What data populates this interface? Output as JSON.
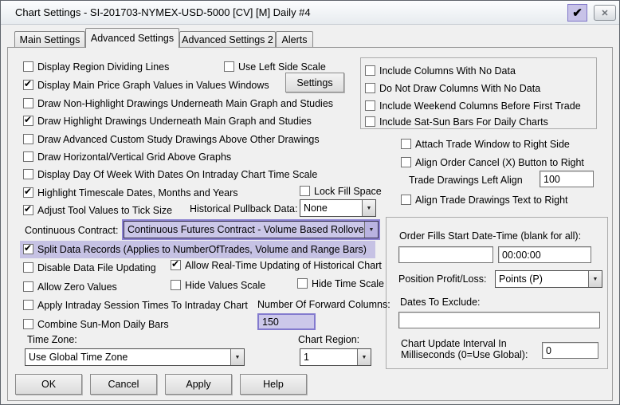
{
  "window": {
    "title": "Chart Settings - SI-201703-NYMEX-USD-5000 [CV] [M]  Daily  #4",
    "controls": {
      "pin_checked": true,
      "pin_glyph": "✔",
      "close_glyph": "✕"
    }
  },
  "tabs": [
    {
      "label": "Main Settings",
      "active": false
    },
    {
      "label": "Advanced Settings",
      "active": true
    },
    {
      "label": "Advanced Settings 2",
      "active": false
    },
    {
      "label": "Alerts",
      "active": false
    }
  ],
  "checks": {
    "display_region_dividing_lines": {
      "label": "Display Region Dividing Lines",
      "checked": false
    },
    "use_left_side_scale": {
      "label": "Use Left Side Scale",
      "checked": false
    },
    "display_main_price": {
      "label": "Display Main Price Graph Values in Values Windows",
      "checked": true
    },
    "draw_non_highlight": {
      "label": "Draw Non-Highlight Drawings Underneath Main Graph and Studies",
      "checked": false
    },
    "draw_highlight": {
      "label": "Draw Highlight Drawings Underneath Main Graph and Studies",
      "checked": true
    },
    "draw_advanced_custom": {
      "label": "Draw Advanced Custom Study Drawings Above Other Drawings",
      "checked": false
    },
    "draw_grid_above": {
      "label": "Draw Horizontal/Vertical Grid Above Graphs",
      "checked": false
    },
    "display_day_of_week": {
      "label": "Display Day Of Week With Dates On Intraday Chart Time Scale",
      "checked": false
    },
    "highlight_timescale": {
      "label": "Highlight Timescale Dates, Months and Years",
      "checked": true
    },
    "lock_fill_space": {
      "label": "Lock Fill Space",
      "checked": false
    },
    "adjust_tool_values": {
      "label": "Adjust Tool Values to Tick Size",
      "checked": true
    },
    "split_data_records": {
      "label": "Split Data Records (Applies to NumberOfTrades, Volume and Range Bars)",
      "checked": true
    },
    "disable_data_file": {
      "label": "Disable Data File Updating",
      "checked": false
    },
    "allow_realtime": {
      "label": "Allow Real-Time Updating of Historical Chart",
      "checked": true
    },
    "allow_zero": {
      "label": "Allow Zero Values",
      "checked": false
    },
    "hide_values_scale": {
      "label": "Hide Values Scale",
      "checked": false
    },
    "hide_time_scale": {
      "label": "Hide Time Scale",
      "checked": false
    },
    "apply_intraday_session": {
      "label": "Apply Intraday Session Times To Intraday Chart",
      "checked": false
    },
    "combine_sun_mon": {
      "label": "Combine Sun-Mon Daily Bars",
      "checked": false
    },
    "include_columns_no_data": {
      "label": "Include Columns With No Data",
      "checked": false
    },
    "do_not_draw_columns": {
      "label": "Do Not Draw Columns With No Data",
      "checked": false
    },
    "include_weekend_columns": {
      "label": "Include Weekend Columns Before First Trade",
      "checked": false
    },
    "include_sat_sun": {
      "label": "Include Sat-Sun Bars For Daily Charts",
      "checked": false
    },
    "attach_trade_window": {
      "label": "Attach Trade Window to Right Side",
      "checked": false
    },
    "align_order_cancel": {
      "label": "Align Order Cancel (X) Button to Right",
      "checked": false
    },
    "align_trade_drawings_text": {
      "label": "Align Trade Drawings Text to Right",
      "checked": false
    }
  },
  "fields": {
    "historical_pullback": {
      "label": "Historical Pullback Data:",
      "value": "None"
    },
    "continuous_contract": {
      "label": "Continuous Contract:",
      "value": "Continuous Futures Contract - Volume Based Rollover"
    },
    "number_forward_columns": {
      "label": "Number Of Forward Columns:",
      "value": "150"
    },
    "time_zone": {
      "label": "Time Zone:",
      "value": "Use Global Time Zone"
    },
    "chart_region": {
      "label": "Chart Region:",
      "value": "1"
    },
    "trade_drawings_left_align": {
      "label": "Trade Drawings Left Align",
      "value": "100"
    },
    "order_fills_start": {
      "label": "Order Fills Start Date-Time (blank for all):",
      "date_value": "",
      "time_value": "00:00:00"
    },
    "position_profit_loss": {
      "label": "Position Profit/Loss:",
      "value": "Points (P)"
    },
    "dates_to_exclude": {
      "label": "Dates To Exclude:",
      "value": ""
    },
    "chart_update_interval": {
      "label_line1": "Chart Update Interval In",
      "label_line2": "Milliseconds (0=Use Global):",
      "value": "0"
    }
  },
  "buttons": {
    "settings": "Settings",
    "ok": "OK",
    "cancel": "Cancel",
    "apply": "Apply",
    "help": "Help"
  },
  "colors": {
    "highlight_fill": "#cbc7e8",
    "highlight_border": "#837ace",
    "dialog_bg": "#f0f0f0"
  }
}
